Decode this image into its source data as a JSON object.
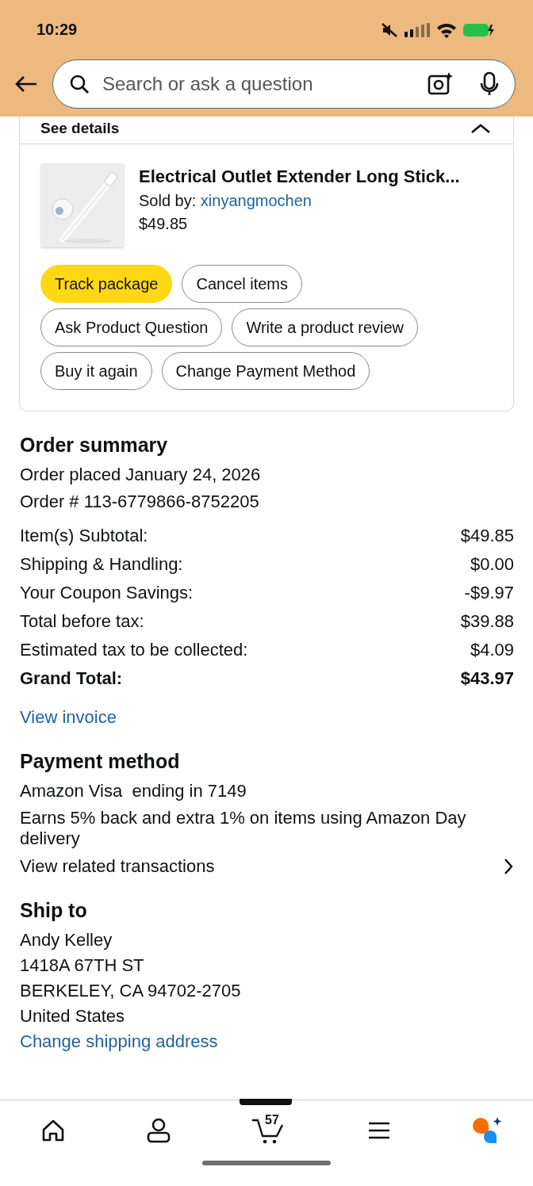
{
  "status_bar": {
    "time": "10:29"
  },
  "search": {
    "placeholder": "Search or ask a question"
  },
  "details_link": "See details",
  "item": {
    "title": "Electrical Outlet Extender Long Stick...",
    "sold_by_label": "Sold by:",
    "seller": "xinyangmochen",
    "price": "$49.85"
  },
  "actions": [
    {
      "label": "Track package",
      "kind": "primary"
    },
    {
      "label": "Cancel items",
      "kind": "secondary"
    },
    {
      "label": "Ask Product Question",
      "kind": "secondary"
    },
    {
      "label": "Write a product review",
      "kind": "secondary"
    },
    {
      "label": "Buy it again",
      "kind": "secondary"
    },
    {
      "label": "Change Payment Method",
      "kind": "secondary"
    }
  ],
  "order_summary": {
    "title": "Order summary",
    "placed": "Order placed January 24, 2026",
    "number": "Order # 113-6779866-8752205",
    "lines": [
      {
        "label": "Item(s) Subtotal:",
        "value": "$49.85",
        "bold": false
      },
      {
        "label": "Shipping & Handling:",
        "value": "$0.00",
        "bold": false
      },
      {
        "label": "Your Coupon Savings:",
        "value": "-$9.97",
        "bold": false
      },
      {
        "label": "Total before tax:",
        "value": "$39.88",
        "bold": false
      },
      {
        "label": "Estimated tax to be collected:",
        "value": "$4.09",
        "bold": false
      },
      {
        "label": "Grand Total:",
        "value": "$43.97",
        "bold": true
      }
    ],
    "invoice_link": "View invoice"
  },
  "payment": {
    "title": "Payment method",
    "card": "Amazon Visa  ending in 7149",
    "note": "Earns 5% back and extra 1% on items using Amazon Day delivery",
    "transactions_link": "View related transactions"
  },
  "ship_to": {
    "title": "Ship to",
    "lines": [
      "Andy Kelley",
      "1418A 67TH ST",
      "BERKELEY, CA 94702-2705",
      "United States"
    ],
    "change_link": "Change shipping address"
  },
  "bottom_nav": {
    "cart_count": "57"
  }
}
